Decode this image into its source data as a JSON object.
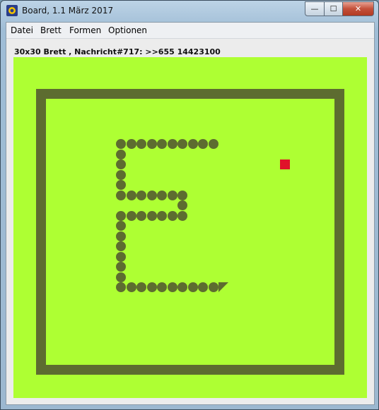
{
  "window": {
    "title": "Board, 1.1 März 2017",
    "controls": {
      "minimize": "—",
      "maximize": "☐",
      "close": "✕"
    }
  },
  "menu": [
    "Datei",
    "Brett",
    "Formen",
    "Optionen"
  ],
  "status_text": "30x30 Brett , Nachricht#717: >>655 14423100",
  "board": {
    "grid_size": 30,
    "colors": {
      "background": "#aeff33",
      "wall": "#5d6c30",
      "snake": "#5d6c30",
      "food": "#e0122a"
    },
    "snake_body": [
      [
        10,
        8
      ],
      [
        11,
        8
      ],
      [
        12,
        8
      ],
      [
        13,
        8
      ],
      [
        14,
        8
      ],
      [
        15,
        8
      ],
      [
        16,
        8
      ],
      [
        17,
        8
      ],
      [
        18,
        8
      ],
      [
        19,
        8
      ],
      [
        10,
        9
      ],
      [
        10,
        10
      ],
      [
        10,
        11
      ],
      [
        10,
        12
      ],
      [
        10,
        13
      ],
      [
        11,
        13
      ],
      [
        12,
        13
      ],
      [
        13,
        13
      ],
      [
        14,
        13
      ],
      [
        15,
        13
      ],
      [
        16,
        13
      ],
      [
        16,
        14
      ],
      [
        10,
        15
      ],
      [
        11,
        15
      ],
      [
        12,
        15
      ],
      [
        13,
        15
      ],
      [
        14,
        15
      ],
      [
        15,
        15
      ],
      [
        16,
        15
      ],
      [
        10,
        16
      ],
      [
        10,
        17
      ],
      [
        10,
        18
      ],
      [
        10,
        19
      ],
      [
        10,
        20
      ],
      [
        10,
        21
      ],
      [
        10,
        22
      ],
      [
        11,
        22
      ],
      [
        12,
        22
      ],
      [
        13,
        22
      ],
      [
        14,
        22
      ],
      [
        15,
        22
      ],
      [
        16,
        22
      ],
      [
        17,
        22
      ],
      [
        18,
        22
      ],
      [
        19,
        22
      ]
    ],
    "snake_head": [
      20,
      22
    ],
    "food": [
      26,
      10
    ]
  }
}
